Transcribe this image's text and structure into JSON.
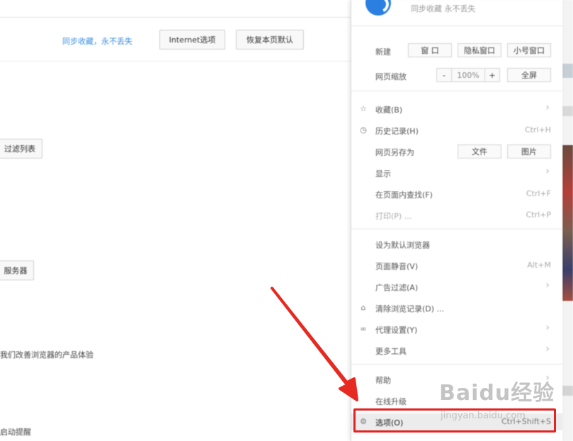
{
  "background_page": {
    "sync_link": "同步收藏，永不丢失",
    "btn_internet": "Internet选项",
    "btn_restore": "恢复本页默认",
    "btn_filterlist": "过滤列表",
    "btn_server": "服务器",
    "text_experience": "我们改善浏览器的产品体验",
    "text_startup": "启动提醒"
  },
  "menu": {
    "sync_text": "同步收藏 永不丢失",
    "new_label": "新建",
    "new_window": "窗 口",
    "private_window": "隐私窗口",
    "small_window": "小号窗口",
    "zoom_label": "网页缩放",
    "zoom_minus": "-",
    "zoom_value": "100%",
    "zoom_plus": "+",
    "fullscreen": "全屏",
    "save_as_label": "网页另存为",
    "save_file": "文件",
    "save_image": "图片",
    "items": {
      "favorites": {
        "label": "收藏(B)"
      },
      "history": {
        "label": "历史记录(H)",
        "shortcut": "Ctrl+H"
      },
      "display": {
        "label": "显示"
      },
      "find": {
        "label": "在页面内查找(F)",
        "shortcut": "Ctrl+F"
      },
      "print": {
        "label": "打印(P) ...",
        "shortcut": "Ctrl+P"
      },
      "set_default": {
        "label": "设为默认浏览器"
      },
      "mute": {
        "label": "页面静音(V)",
        "shortcut": "Alt+M"
      },
      "adblock": {
        "label": "广告过滤(A)"
      },
      "clear": {
        "label": "清除浏览记录(D) ..."
      },
      "proxy": {
        "label": "代理设置(Y)"
      },
      "more_tools": {
        "label": "更多工具"
      },
      "help": {
        "label": "帮助"
      },
      "upgrade": {
        "label": "在线升级"
      },
      "options": {
        "label": "选项(O)",
        "shortcut": "Ctrl+Shift+S"
      }
    }
  },
  "watermark": {
    "brand": "Baidu经验",
    "url": "jingyan.baidu.com"
  },
  "colors": {
    "highlight": "#e32222",
    "arrow": "#e62a22",
    "link": "#3b8fe0",
    "logo": "#2a7fe0"
  }
}
